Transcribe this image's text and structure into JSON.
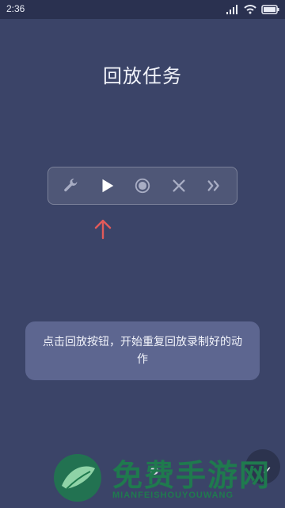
{
  "status_bar": {
    "time": "2:36"
  },
  "page": {
    "title": "回放任务"
  },
  "toolbar": {
    "buttons": [
      {
        "name": "wrench-icon"
      },
      {
        "name": "play-icon"
      },
      {
        "name": "record-icon"
      },
      {
        "name": "close-icon"
      },
      {
        "name": "fast-forward-icon"
      }
    ]
  },
  "tip": {
    "text": "点击回放按钮，开始重复回放录制好的动作"
  },
  "colors": {
    "background": "#3b4468",
    "toolbar_border": "rgba(255,255,255,0.25)",
    "tip_background": "#5d6690",
    "arrow": "#e05a5a"
  },
  "watermark": {
    "title": "免费手游网",
    "subtitle": "MIANFEISHOUYOUWANG"
  }
}
